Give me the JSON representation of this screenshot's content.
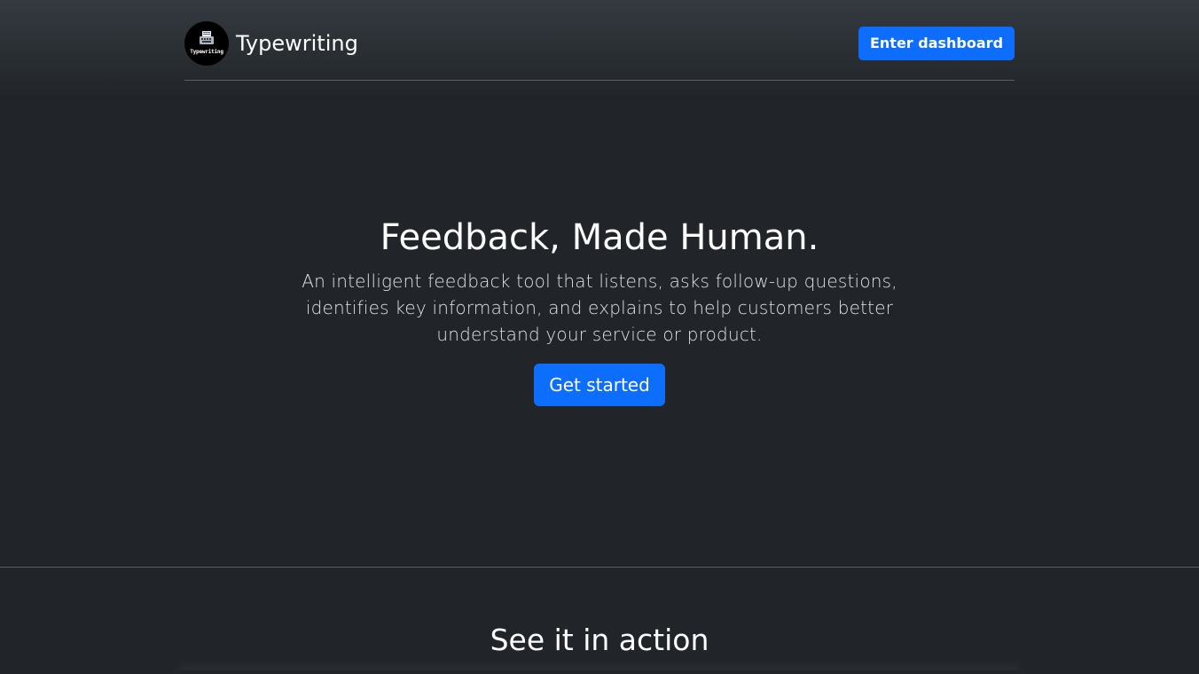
{
  "navbar": {
    "brand_name": "Typewriting",
    "logo_text": "Typewriting",
    "dashboard_button": "Enter dashboard"
  },
  "hero": {
    "title": "Feedback, Made Human.",
    "lead": "An intelligent feedback tool that listens, asks follow-up questions, identifies key information, and explains to help customers better understand your service or product.",
    "cta_button": "Get started"
  },
  "action": {
    "title": "See it in action"
  },
  "icons": {
    "logo": "typewriter-icon"
  },
  "colors": {
    "primary": "#0d6efd",
    "background": "#212529",
    "header_gradient_top": "#343a40"
  }
}
